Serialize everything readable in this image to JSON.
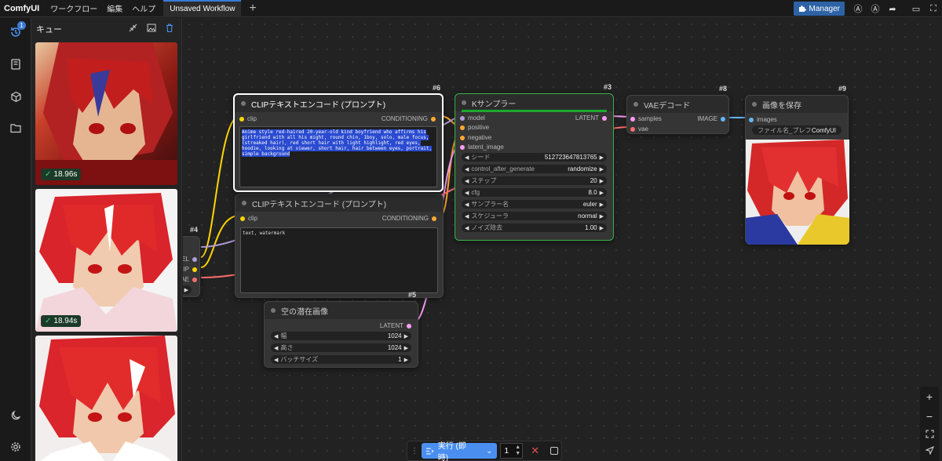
{
  "app": {
    "logo": "ComfyUI"
  },
  "menu": [
    "ワークフロー",
    "編集",
    "ヘルプ"
  ],
  "tab": {
    "label": "Unsaved Workflow"
  },
  "top_right": {
    "manager_label": "Manager"
  },
  "sidebar": {
    "queue_badge": "1"
  },
  "queue": {
    "title": "キュー",
    "items": [
      {
        "time": "18.96s"
      },
      {
        "time": "18.94s"
      },
      {
        "time": ""
      }
    ]
  },
  "nodes": {
    "clip_pos": {
      "id": "#6",
      "title": "CLIPテキストエンコード (プロンプト)",
      "input": "clip",
      "output": "CONDITIONING",
      "text": "Anime style red-haired 20-year-old kind boyfriend who affirms his girlfriend with all his might, round chin, 1boy, solo, male focus, (streaked hair), red short hair with light highlight, red eyes, hoodie, looking at viewer, short hair, hair between eyes, portrait, simple background"
    },
    "clip_neg": {
      "title": "CLIPテキストエンコード (プロンプト)",
      "input": "clip",
      "output": "CONDITIONING",
      "text": "text, watermark"
    },
    "ksampler": {
      "id": "#3",
      "title": "Kサンプラー",
      "inputs": [
        "model",
        "positive",
        "negative",
        "latent_image"
      ],
      "output": "LATENT",
      "widgets": [
        {
          "label": "シード",
          "value": "512723647813765"
        },
        {
          "label": "control_after_generate",
          "value": "randomize"
        },
        {
          "label": "ステップ",
          "value": "20"
        },
        {
          "label": "cfg",
          "value": "8.0"
        },
        {
          "label": "サンプラー名",
          "value": "euler"
        },
        {
          "label": "スケジューラ",
          "value": "normal"
        },
        {
          "label": "ノイズ除去",
          "value": "1.00"
        }
      ]
    },
    "vae": {
      "id": "#8",
      "title": "VAEデコード",
      "inputs": [
        "samples",
        "vae"
      ],
      "output": "IMAGE"
    },
    "save": {
      "id": "#9",
      "title": "画像を保存",
      "input": "images",
      "prefix_label": "ファイル名_プレフ",
      "prefix_value": "ComfyUI"
    },
    "latent": {
      "id": "#5",
      "title": "空の潜在画像",
      "output": "LATENT",
      "widgets": [
        {
          "label": "幅",
          "value": "1024"
        },
        {
          "label": "高さ",
          "value": "1024"
        },
        {
          "label": "バッチサイズ",
          "value": "1"
        }
      ]
    },
    "checkpoint": {
      "id": "#4",
      "outputs": [
        "EL",
        "IP",
        "AE"
      ]
    }
  },
  "runbar": {
    "run_label": "実行 (即時)",
    "batch": "1"
  },
  "colors": {
    "accent": "#3a7bd5",
    "clip": "#ffd500",
    "cond": "#ffa931",
    "latent": "#ff9cf9",
    "model": "#b39ddb",
    "vae": "#ff6e6e",
    "image": "#64b5f6"
  }
}
